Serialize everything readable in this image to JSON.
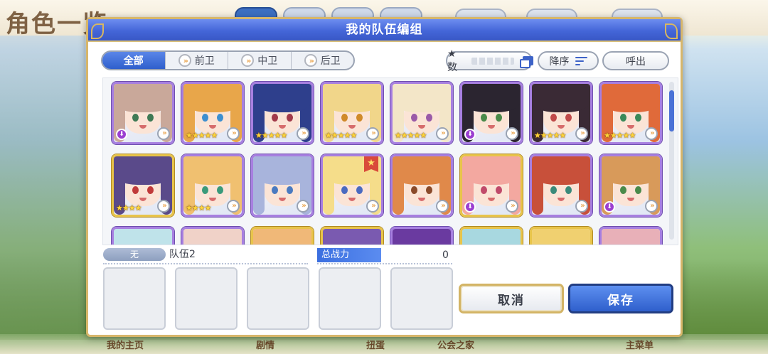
{
  "background": {
    "title": "角色一览",
    "nav": [
      "我的主页",
      "剧情",
      "公会之家",
      "扭蛋",
      "主菜单"
    ]
  },
  "dialog": {
    "title": "我的队伍编组",
    "filters": [
      {
        "label": "全部",
        "active": true
      },
      {
        "label": "前卫",
        "active": false
      },
      {
        "label": "中卫",
        "active": false
      },
      {
        "label": "后卫",
        "active": false
      }
    ],
    "sort_field": "★数",
    "sort_order": "降序",
    "call_button": "呼出",
    "roster": [
      {
        "stars": "",
        "locked": true,
        "frame": "purple",
        "hair": "#c9a89a",
        "eyes": "#3f7a55"
      },
      {
        "stars": "★★★★★",
        "locked": false,
        "frame": "purple",
        "hair": "#e8a64a",
        "eyes": "#3d8fd0"
      },
      {
        "stars": "★★★★★",
        "locked": false,
        "frame": "purple",
        "hair": "#2e3f8c",
        "eyes": "#a23a4a"
      },
      {
        "stars": "★★★★★",
        "locked": false,
        "frame": "purple",
        "hair": "#f1d68a",
        "eyes": "#d08a2a"
      },
      {
        "stars": "★★★★★",
        "locked": false,
        "frame": "purple",
        "hair": "#f3e6c8",
        "eyes": "#9a5aa8"
      },
      {
        "stars": "",
        "locked": true,
        "frame": "purple",
        "hair": "#2b2530",
        "eyes": "#4a8a4a"
      },
      {
        "stars": "★★★★★",
        "locked": false,
        "frame": "purple",
        "hair": "#3a2a35",
        "eyes": "#c04a4a"
      },
      {
        "stars": "★★★★★",
        "locked": false,
        "frame": "purple",
        "hair": "#e06a3a",
        "eyes": "#3a8a5a"
      },
      {
        "stars": "★★★★",
        "locked": false,
        "frame": "gold",
        "hair": "#5a4a8a",
        "eyes": "#c03a3a"
      },
      {
        "stars": "★★★★",
        "locked": false,
        "frame": "purple",
        "hair": "#f0c070",
        "eyes": "#3a9a7a"
      },
      {
        "stars": "",
        "locked": false,
        "frame": "purple",
        "hair": "#a8b4dc",
        "eyes": "#4a7ac0"
      },
      {
        "stars": "",
        "locked": false,
        "frame": "purple",
        "hair": "#f5dd8a",
        "eyes": "#4a6ac0",
        "favorite": true
      },
      {
        "stars": "",
        "locked": false,
        "frame": "purple",
        "hair": "#e0894a",
        "eyes": "#8a4a2a"
      },
      {
        "stars": "",
        "locked": true,
        "frame": "gold",
        "hair": "#f3a8a0",
        "eyes": "#c04a6a"
      },
      {
        "stars": "",
        "locked": false,
        "frame": "purple",
        "hair": "#c8503a",
        "eyes": "#3a8a7a"
      },
      {
        "stars": "",
        "locked": true,
        "frame": "purple",
        "hair": "#d89a5a",
        "eyes": "#4a8a4a"
      },
      {
        "stars": "",
        "locked": false,
        "frame": "purple",
        "hair": "#bfe3ea",
        "eyes": "#4a8ac0"
      },
      {
        "stars": "",
        "locked": false,
        "frame": "purple",
        "hair": "#f0d2c8",
        "eyes": "#8a4a6a"
      },
      {
        "stars": "",
        "locked": false,
        "frame": "gold",
        "hair": "#f0b878",
        "eyes": "#8a5a3a"
      },
      {
        "stars": "",
        "locked": false,
        "frame": "gold",
        "hair": "#7a5ab0",
        "eyes": "#4a4a8a"
      },
      {
        "stars": "",
        "locked": false,
        "frame": "purple",
        "hair": "#6a3aa0",
        "eyes": "#4a4a8a"
      },
      {
        "stars": "",
        "locked": false,
        "frame": "gold",
        "hair": "#a8d8e0",
        "eyes": "#4a8ac0"
      },
      {
        "stars": "",
        "locked": false,
        "frame": "gold",
        "hair": "#f0d070",
        "eyes": "#8a6a3a"
      },
      {
        "stars": "",
        "locked": false,
        "frame": "purple",
        "hair": "#e8b0b8",
        "eyes": "#8a4a6a"
      }
    ],
    "team": {
      "tag": "无",
      "name": "队伍2",
      "power_label": "总战力",
      "power_value": "0",
      "slots": 5
    },
    "cancel_button": "取消",
    "save_button": "保存"
  }
}
